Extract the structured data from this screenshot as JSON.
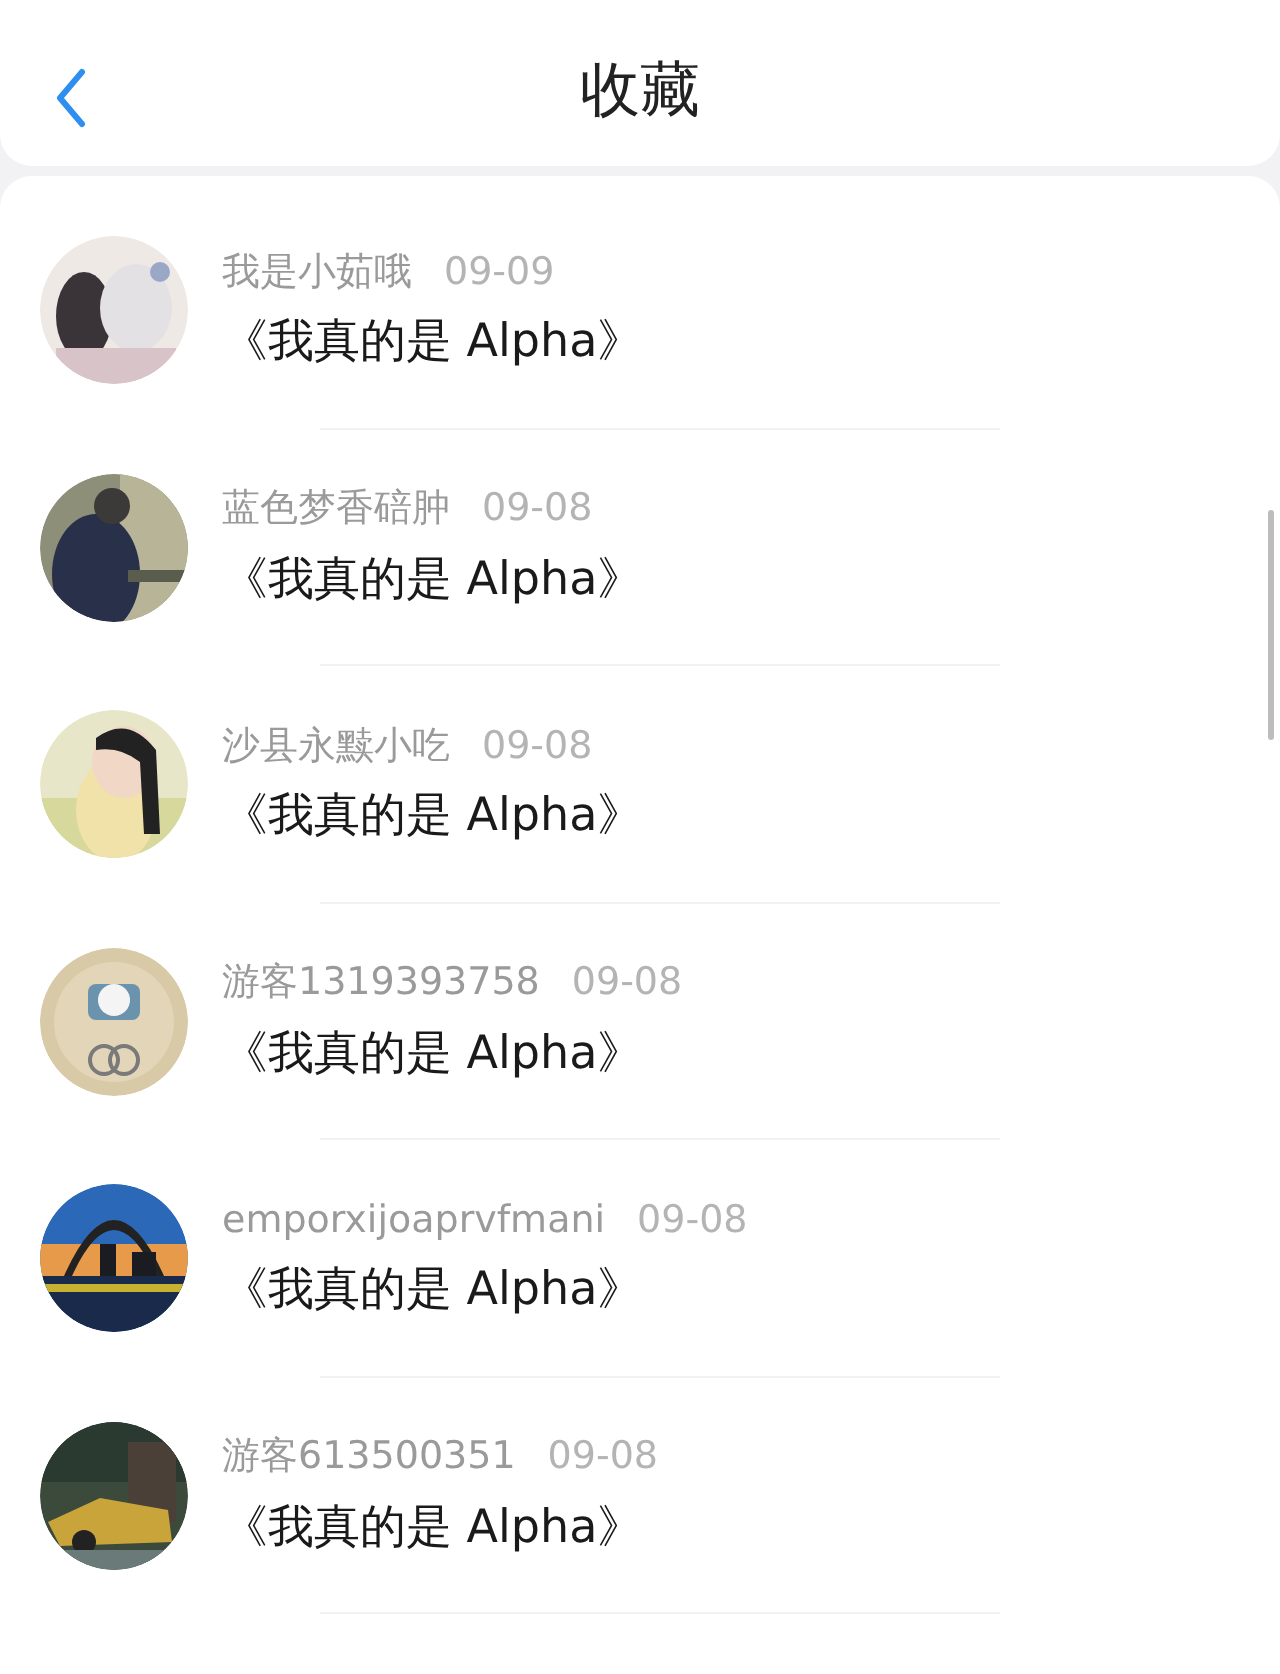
{
  "header": {
    "title": "收藏"
  },
  "favorites": [
    {
      "author": "我是小茹哦",
      "date": "09-09",
      "title": "《我真的是 Alpha》"
    },
    {
      "author": "蓝色梦香碚肿",
      "date": "09-08",
      "title": "《我真的是 Alpha》"
    },
    {
      "author": "沙县永黩小吃",
      "date": "09-08",
      "title": "《我真的是 Alpha》"
    },
    {
      "author": "游客1319393758",
      "date": "09-08",
      "title": "《我真的是 Alpha》"
    },
    {
      "author": "emporxijoaprvfmani",
      "date": "09-08",
      "title": "《我真的是 Alpha》"
    },
    {
      "author": "游客613500351",
      "date": "09-08",
      "title": "《我真的是 Alpha》"
    }
  ]
}
